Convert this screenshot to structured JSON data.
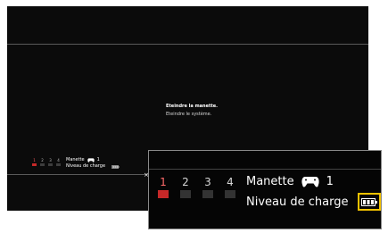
{
  "menu": {
    "items": [
      "Eteindre la manette.",
      "Eteindre le système."
    ],
    "selected_index": 0
  },
  "controller_ports": {
    "numbers": [
      "1",
      "2",
      "3",
      "4"
    ],
    "active_port": 1
  },
  "status": {
    "controller_label": "Manette",
    "controller_number": "1",
    "charge_label": "Niveau de charge"
  },
  "misc": {
    "x_mark": "×"
  },
  "colors": {
    "active_port": "#c62828",
    "highlight_box": "#f2c200",
    "background": "#0b0b0b"
  },
  "icons": [
    "controller-icon",
    "battery-icon"
  ]
}
